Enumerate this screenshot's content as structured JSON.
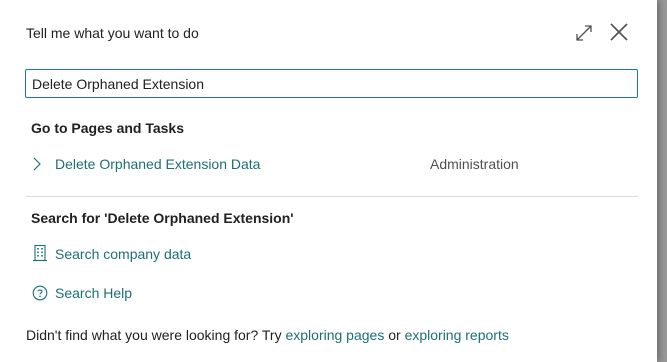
{
  "dialog": {
    "title": "Tell me what you want to do",
    "expand_icon": "expand-icon",
    "close_icon": "close-icon"
  },
  "search": {
    "value": "Delete Orphaned Extension"
  },
  "pages_section": {
    "heading": "Go to Pages and Tasks",
    "results": [
      {
        "label": "Delete Orphaned Extension Data",
        "category": "Administration",
        "icon": "chevron-right-icon"
      }
    ]
  },
  "search_section": {
    "heading": "Search for 'Delete Orphaned Extension'",
    "company_data": {
      "label": "Search company data",
      "icon": "building-icon"
    },
    "help": {
      "label": "Search Help",
      "icon": "question-circle-icon"
    }
  },
  "footer": {
    "prefix": "Didn't find what you were looking for? Try ",
    "link_pages": "exploring pages",
    "middle": " or ",
    "link_reports": "exploring reports"
  },
  "colors": {
    "accent": "#1d6f77",
    "input_border": "#1f7f86",
    "text": "#212121"
  }
}
